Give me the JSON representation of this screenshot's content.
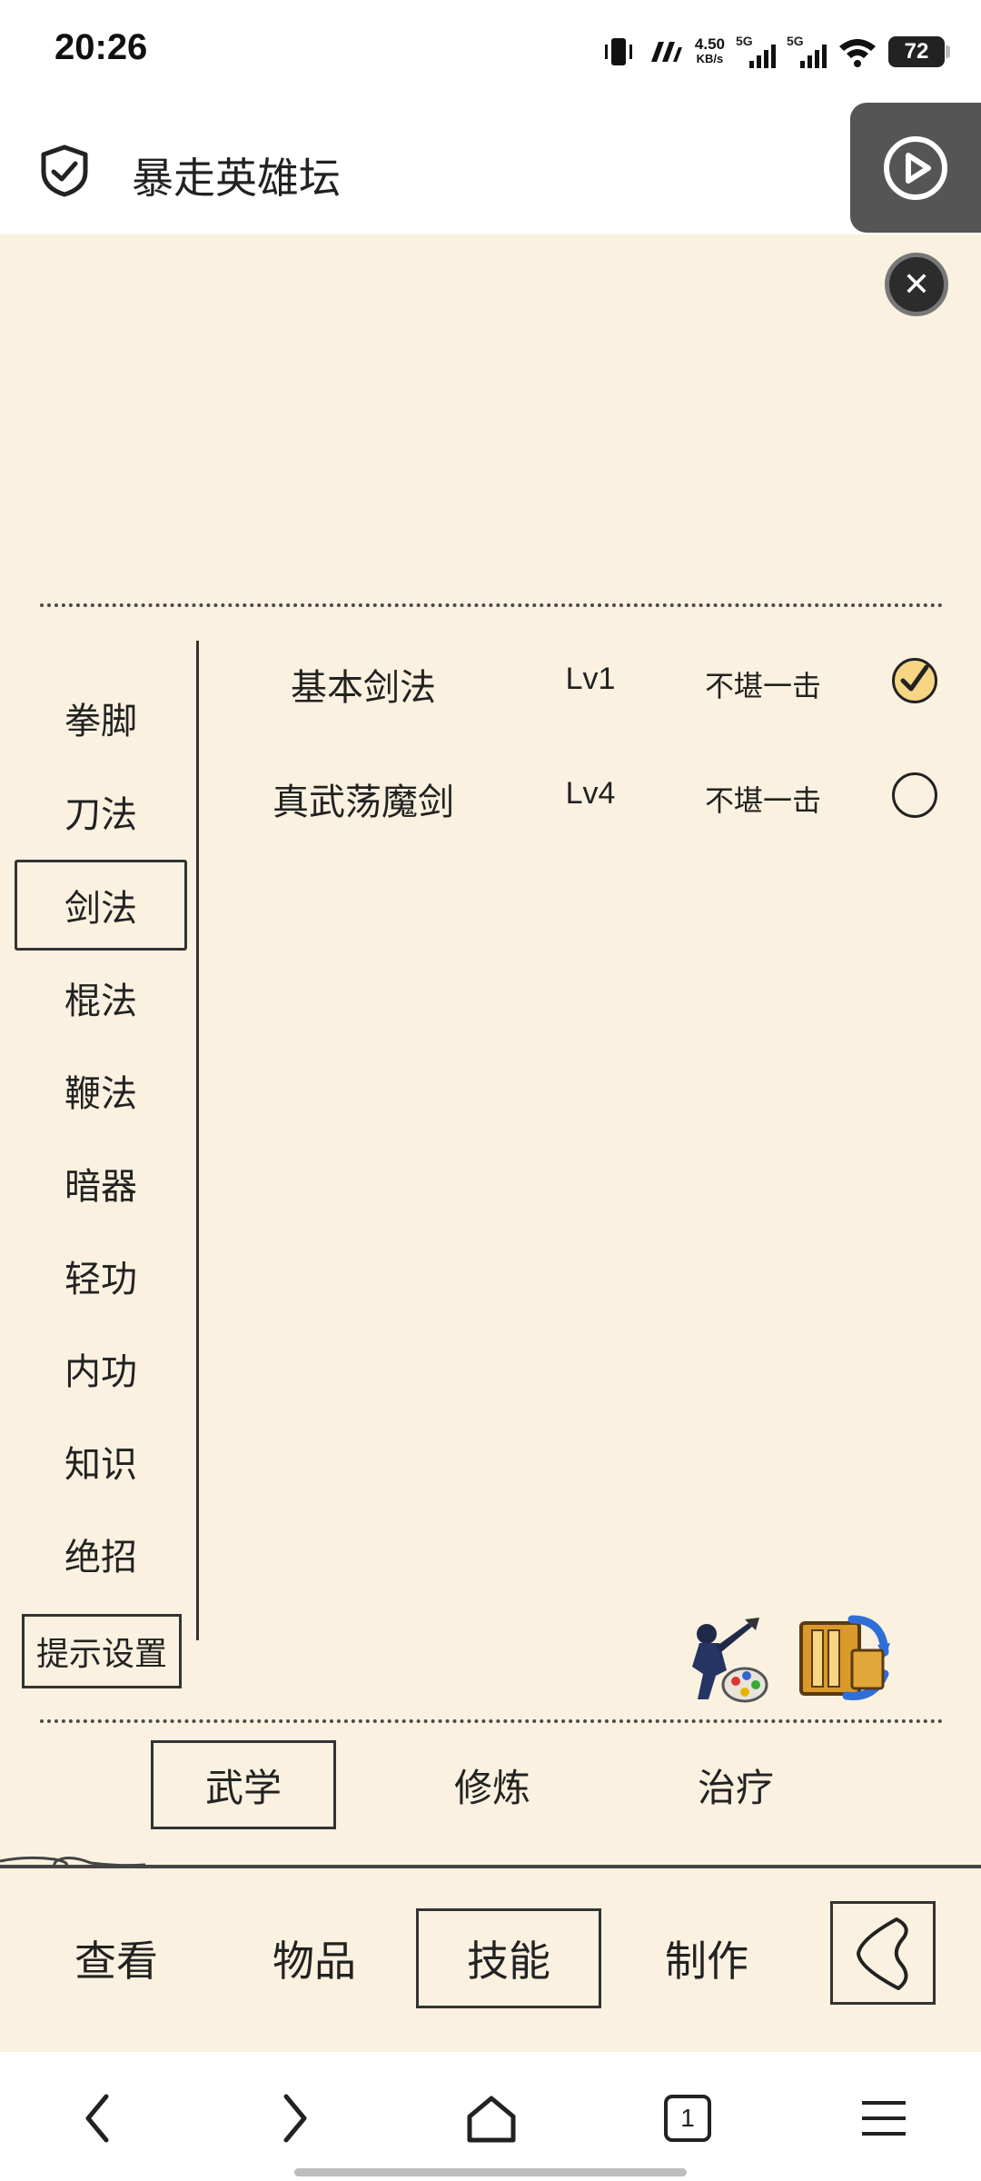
{
  "status_bar": {
    "time": "20:26",
    "net_speed": "4.50",
    "net_unit": "KB/s",
    "sim1": "5G",
    "sim2": "5G",
    "battery": "72"
  },
  "browser": {
    "title": "暴走英雄坛"
  },
  "skill_categories": [
    {
      "label": "拳脚",
      "selected": false
    },
    {
      "label": "刀法",
      "selected": false
    },
    {
      "label": "剑法",
      "selected": true
    },
    {
      "label": "棍法",
      "selected": false
    },
    {
      "label": "鞭法",
      "selected": false
    },
    {
      "label": "暗器",
      "selected": false
    },
    {
      "label": "轻功",
      "selected": false
    },
    {
      "label": "内功",
      "selected": false
    },
    {
      "label": "知识",
      "selected": false
    },
    {
      "label": "绝招",
      "selected": false
    }
  ],
  "hint_button": "提示设置",
  "skills": [
    {
      "name": "基本剑法",
      "level": "Lv1",
      "rank": "不堪一击",
      "equipped": true
    },
    {
      "name": "真武荡魔剑",
      "level": "Lv4",
      "rank": "不堪一击",
      "equipped": false
    }
  ],
  "sub_tabs": [
    {
      "label": "武学",
      "selected": true
    },
    {
      "label": "修炼",
      "selected": false
    },
    {
      "label": "治疗",
      "selected": false
    }
  ],
  "bottom_tabs": [
    {
      "label": "查看",
      "selected": false
    },
    {
      "label": "物品",
      "selected": false
    },
    {
      "label": "技能",
      "selected": true
    },
    {
      "label": "制作",
      "selected": false
    }
  ],
  "nav": {
    "tab_count": "1"
  },
  "colors": {
    "game_bg": "#faf1e0",
    "ink": "#333333",
    "check_fill": "#f6d684"
  }
}
